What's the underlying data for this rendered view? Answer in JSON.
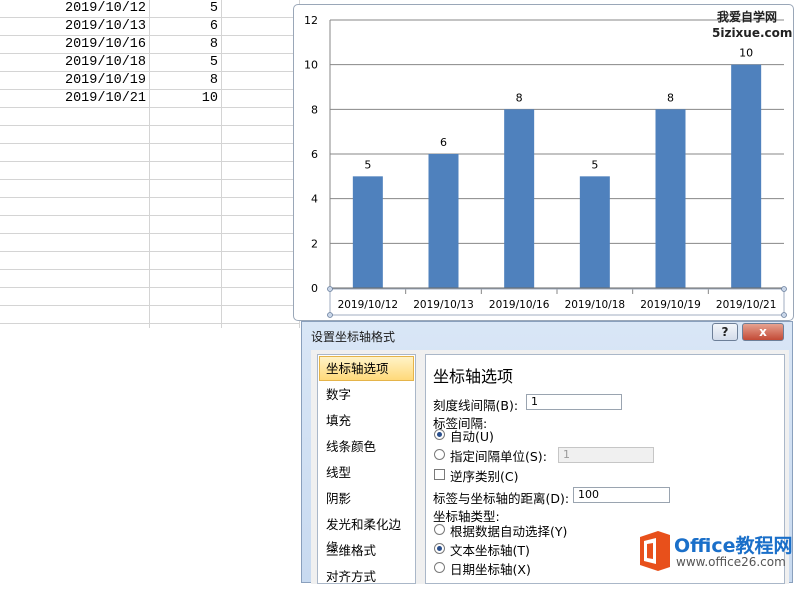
{
  "spreadsheet": {
    "rows": [
      {
        "date": "2019/10/12",
        "value": "5"
      },
      {
        "date": "2019/10/13",
        "value": "6"
      },
      {
        "date": "2019/10/16",
        "value": "8"
      },
      {
        "date": "2019/10/18",
        "value": "5"
      },
      {
        "date": "2019/10/19",
        "value": "8"
      },
      {
        "date": "2019/10/21",
        "value": "10"
      }
    ]
  },
  "chart_data": {
    "type": "bar",
    "categories": [
      "2019/10/12",
      "2019/10/13",
      "2019/10/16",
      "2019/10/18",
      "2019/10/19",
      "2019/10/21"
    ],
    "values": [
      5,
      6,
      8,
      5,
      8,
      10
    ],
    "data_labels": [
      "5",
      "6",
      "8",
      "5",
      "8",
      "10"
    ],
    "ylim": [
      0,
      12
    ],
    "yticks": [
      0,
      2,
      4,
      6,
      8,
      10,
      12
    ],
    "grid": true,
    "bar_color": "#4f81bd",
    "title": "",
    "xlabel": "",
    "ylabel": ""
  },
  "watermark": {
    "line1": "我爱自学网",
    "line2": "5izixue.com"
  },
  "dialog": {
    "title": "设置坐标轴格式",
    "help_label": "?",
    "close_label": "x",
    "categories": [
      "坐标轴选项",
      "数字",
      "填充",
      "线条颜色",
      "线型",
      "阴影",
      "发光和柔化边缘",
      "三维格式",
      "对齐方式"
    ],
    "selected_category": "坐标轴选项",
    "panel": {
      "title": "坐标轴选项",
      "tick_interval_label": "刻度线间隔(B):",
      "tick_interval_value": "1",
      "label_interval_label": "标签间隔:",
      "auto_label": "自动(U)",
      "specify_label": "指定间隔单位(S):",
      "specify_value": "1",
      "reverse_label": "逆序类别(C)",
      "distance_label": "标签与坐标轴的距离(D):",
      "distance_value": "100",
      "axis_type_label": "坐标轴类型:",
      "auto_select_label": "根据数据自动选择(Y)",
      "text_axis_label": "文本坐标轴(T)",
      "date_axis_label": "日期坐标轴(X)",
      "auto_selected": false,
      "text_selected": true,
      "date_selected": false
    }
  },
  "logo": {
    "name": "Office教程网",
    "url": "www.office26.com",
    "brand_color": "#e8501b"
  }
}
